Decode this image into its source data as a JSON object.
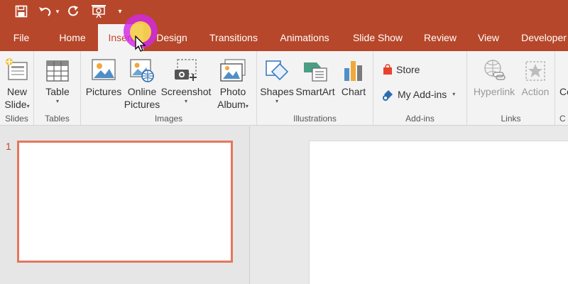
{
  "qat": {
    "save_icon": "save-icon",
    "undo_icon": "undo-icon",
    "redo_icon": "redo-icon",
    "present_icon": "present-from-start-icon",
    "customize_icon": "customize-qat-icon",
    "undo_caret": "▾",
    "customize_caret": "▾"
  },
  "tabs": [
    {
      "label": "File"
    },
    {
      "label": "Home"
    },
    {
      "label": "Insert"
    },
    {
      "label": "Design"
    },
    {
      "label": "Transitions"
    },
    {
      "label": "Animations"
    },
    {
      "label": "Slide Show"
    },
    {
      "label": "Review"
    },
    {
      "label": "View"
    },
    {
      "label": "Developer"
    }
  ],
  "ribbon": {
    "slides": {
      "group_label": "Slides",
      "new_slide_line1": "New",
      "new_slide_line2": "Slide",
      "caret": "▾"
    },
    "tables": {
      "group_label": "Tables",
      "table": "Table",
      "caret": "▾"
    },
    "images": {
      "group_label": "Images",
      "pictures": "Pictures",
      "online_line1": "Online",
      "online_line2": "Pictures",
      "screenshot": "Screenshot",
      "screenshot_caret": "▾",
      "album_line1": "Photo",
      "album_line2": "Album",
      "album_caret": "▾"
    },
    "illustrations": {
      "group_label": "Illustrations",
      "shapes": "Shapes",
      "shapes_caret": "▾",
      "smartart": "SmartArt",
      "chart": "Chart"
    },
    "addins": {
      "group_label": "Add-ins",
      "store": "Store",
      "my_addins": "My Add-ins",
      "caret": "▾"
    },
    "links": {
      "group_label": "Links",
      "hyperlink": "Hyperlink",
      "action": "Action"
    },
    "overflow": {
      "label": "Co",
      "group_label": "C"
    }
  },
  "slides_pane": {
    "slide_number": "1"
  },
  "colors": {
    "accent": "#b7472a",
    "active_tab_text": "#c4462b",
    "thumb_border": "#e3785d"
  }
}
